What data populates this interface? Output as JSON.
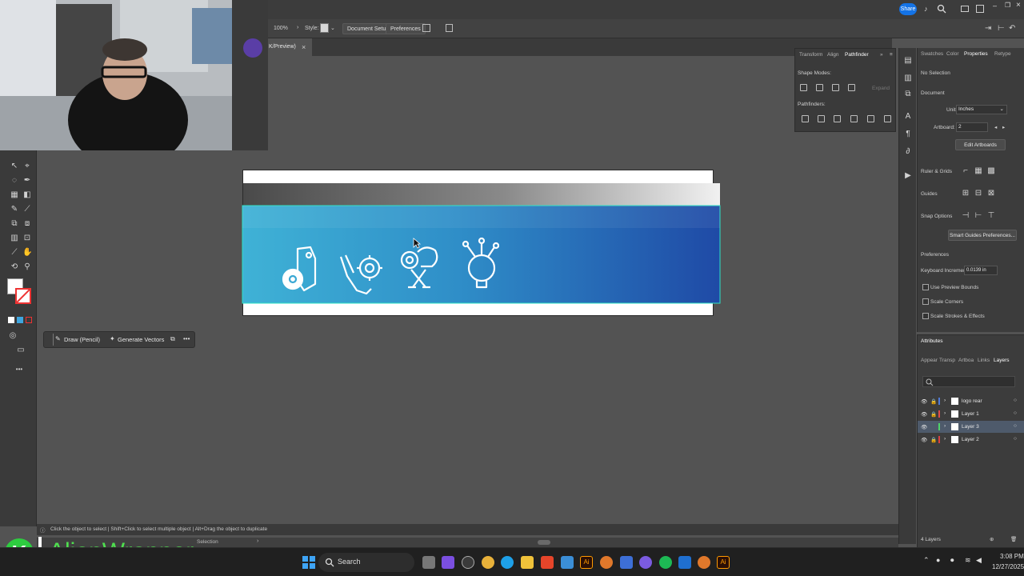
{
  "app": {
    "zoom": "100%",
    "style_label": "Style:",
    "share_label": "Share"
  },
  "controlbar": {
    "document_setup": "Document Setup",
    "preferences": "Preferences"
  },
  "document_tab": {
    "title": "K/Preview)",
    "close": "×"
  },
  "context_bar": {
    "draw_pencil": "Draw (Pencil)",
    "generate_vectors": "Generate Vectors",
    "more": "•••"
  },
  "pathfinder_panel": {
    "tabs": [
      "Transform",
      "Align",
      "Pathfinder"
    ],
    "shape_modes": "Shape Modes:",
    "expand": "Expand",
    "pathfinders": "Pathfinders:"
  },
  "properties_panel": {
    "tabs": [
      "Swatches",
      "Color",
      "Properties",
      "Retype"
    ],
    "no_selection": "No Selection",
    "document": "Document",
    "units_label": "Units:",
    "units_value": "Inches",
    "artboard_label": "Artboard:",
    "artboard_value": "2",
    "edit_artboards": "Edit Artboards",
    "ruler_grids": "Ruler & Grids",
    "guides": "Guides",
    "snap_options": "Snap Options",
    "smart_guides_prefs": "Smart Guides Preferences...",
    "preferences": "Preferences",
    "keyboard_increment_label": "Keyboard Increment:",
    "keyboard_increment_value": "0.0139 in",
    "use_preview_bounds": "Use Preview Bounds",
    "scale_corners": "Scale Corners",
    "scale_strokes": "Scale Strokes & Effects"
  },
  "layers_panel": {
    "attributes": "Attributes",
    "tabs": [
      "Appear",
      "Transp",
      "Artboa",
      "Links",
      "Layers"
    ],
    "layers": [
      {
        "name": "logo rear",
        "color": "#4f7ad8"
      },
      {
        "name": "Layer 1",
        "color": "#e04a4a"
      },
      {
        "name": "Layer 3",
        "color": "#4fd36a"
      },
      {
        "name": "Layer 2",
        "color": "#d94040"
      }
    ],
    "count": "4 Layers"
  },
  "statusbar": {
    "hint": "Click the object to select  |  Shift+Click to select multiple object  |  Alt+Drag the object to duplicate",
    "zoom": "25%",
    "tool": "Selection"
  },
  "taskbar": {
    "search": "Search",
    "time": "3:08 PM",
    "date": "12/27/2025"
  },
  "watermark": {
    "brand": "AlienWrapper",
    "letter": "K"
  },
  "colors": {
    "banner_start": "#3fb2d6",
    "banner_end": "#1f4aa6",
    "accent_blue": "#1473e6"
  }
}
